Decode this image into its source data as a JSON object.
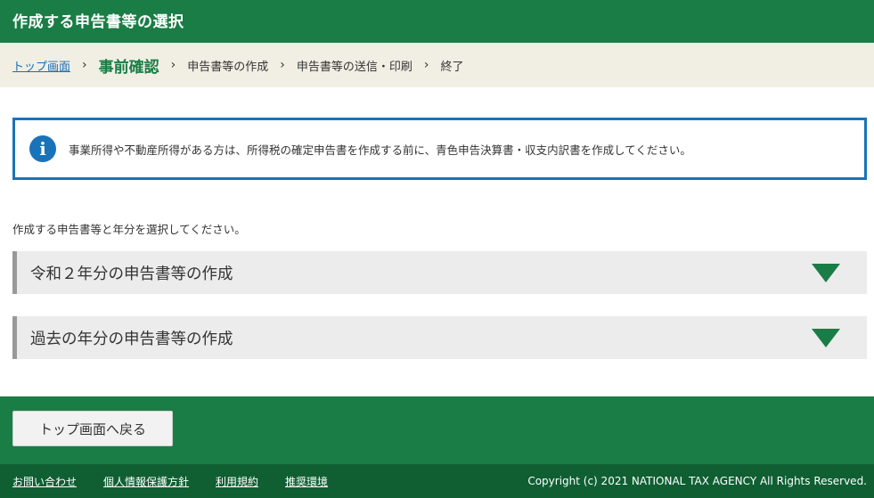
{
  "header": {
    "title": "作成する申告書等の選択"
  },
  "breadcrumb": {
    "items": [
      {
        "label": "トップ画面"
      },
      {
        "label": "事前確認"
      },
      {
        "label": "申告書等の作成"
      },
      {
        "label": "申告書等の送信・印刷"
      },
      {
        "label": "終了"
      }
    ],
    "separator": "›"
  },
  "info": {
    "icon": "info-icon",
    "icon_glyph": "i",
    "text": "事業所得や不動産所得がある方は、所得税の確定申告書を作成する前に、青色申告決算書・収支内訳書を作成してください。"
  },
  "instruction": "作成する申告書等と年分を選択してください。",
  "accordions": [
    {
      "label": "令和２年分の申告書等の作成"
    },
    {
      "label": "過去の年分の申告書等の作成"
    }
  ],
  "back_button": {
    "label": "トップ画面へ戻る"
  },
  "footer": {
    "links": [
      {
        "label": "お問い合わせ"
      },
      {
        "label": "個人情報保護方針"
      },
      {
        "label": "利用規約"
      },
      {
        "label": "推奨環境"
      }
    ],
    "copyright": "Copyright (c) 2021 NATIONAL TAX AGENCY All Rights Reserved."
  },
  "colors": {
    "brand_green": "#1a7d46",
    "dark_green": "#0f5f33",
    "info_blue": "#1a73b8",
    "link_blue": "#1a6cb5",
    "breadcrumb_bg": "#f1efe4"
  }
}
